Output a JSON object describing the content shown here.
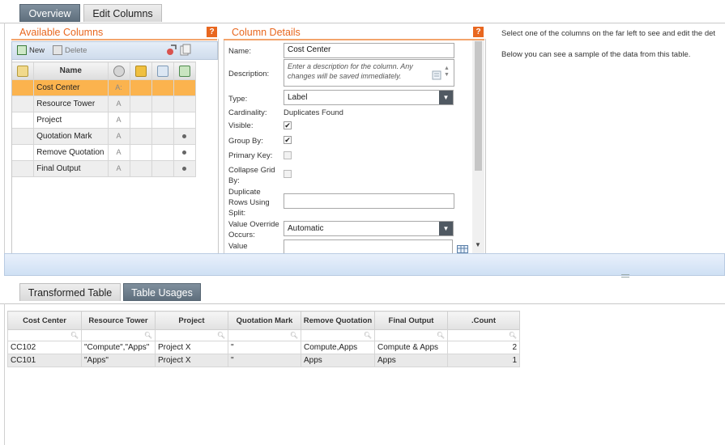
{
  "top_tabs": [
    {
      "label": "Overview",
      "active": false
    },
    {
      "label": "Edit Columns",
      "active": true
    }
  ],
  "available_columns": {
    "title": "Available Columns",
    "help": "?",
    "toolbar": {
      "new_label": "New",
      "delete_label": "Delete"
    },
    "header": {
      "name": "Name"
    },
    "rows": [
      {
        "name": "Cost Center",
        "type": "A:",
        "remove_quote": false,
        "selected": true
      },
      {
        "name": "Resource Tower",
        "type": "A",
        "remove_quote": false
      },
      {
        "name": "Project",
        "type": "A",
        "remove_quote": false
      },
      {
        "name": "Quotation Mark",
        "type": "A",
        "remove_quote": true
      },
      {
        "name": "Remove Quotation",
        "type": "A",
        "remove_quote": true
      },
      {
        "name": "Final Output",
        "type": "A",
        "remove_quote": true
      }
    ]
  },
  "column_details": {
    "title": "Column Details",
    "help": "?",
    "name_label": "Name:",
    "name_value": "Cost Center",
    "description_label": "Description:",
    "description_placeholder": "Enter a description for the column. Any changes will be saved immediately.",
    "type_label": "Type:",
    "type_value": "Label",
    "cardinality_label": "Cardinality:",
    "cardinality_value": "Duplicates Found",
    "visible_label": "Visible:",
    "visible_checked": true,
    "groupby_label": "Group By:",
    "groupby_checked": true,
    "primarykey_label": "Primary Key:",
    "primarykey_checked": false,
    "collapse_label_1": "Collapse Grid",
    "collapse_label_2": "By:",
    "collapse_checked": false,
    "duprows_label_1": "Duplicate",
    "duprows_label_2": "Rows Using",
    "duprows_label_3": "Split:",
    "override_label_1": "Value Override",
    "override_label_2": "Occurs:",
    "override_value": "Automatic",
    "value_label": "Value"
  },
  "info": {
    "line1": "Select one of the columns on the far left to see and edit the det",
    "line2": "Below you can see a sample of the data from this table."
  },
  "bottom_tabs": [
    {
      "label": "Transformed Table",
      "active": false
    },
    {
      "label": "Table Usages",
      "active": true
    }
  ],
  "data_table": {
    "headers": [
      "Cost Center",
      "Resource Tower",
      "Project",
      "Quotation Mark",
      "Remove Quotation",
      "Final Output",
      ".Count"
    ],
    "rows": [
      [
        "CC102",
        "\"Compute\",\"Apps\"",
        "Project X",
        "\"",
        "Compute,Apps",
        "Compute & Apps",
        "2"
      ],
      [
        "CC101",
        "\"Apps\"",
        "Project X",
        "\"",
        "Apps",
        "Apps",
        "1"
      ]
    ]
  },
  "colors": {
    "accent_orange": "#e8671f",
    "selected_row": "#fbb34e",
    "tab_dark": "#6b7b89"
  }
}
